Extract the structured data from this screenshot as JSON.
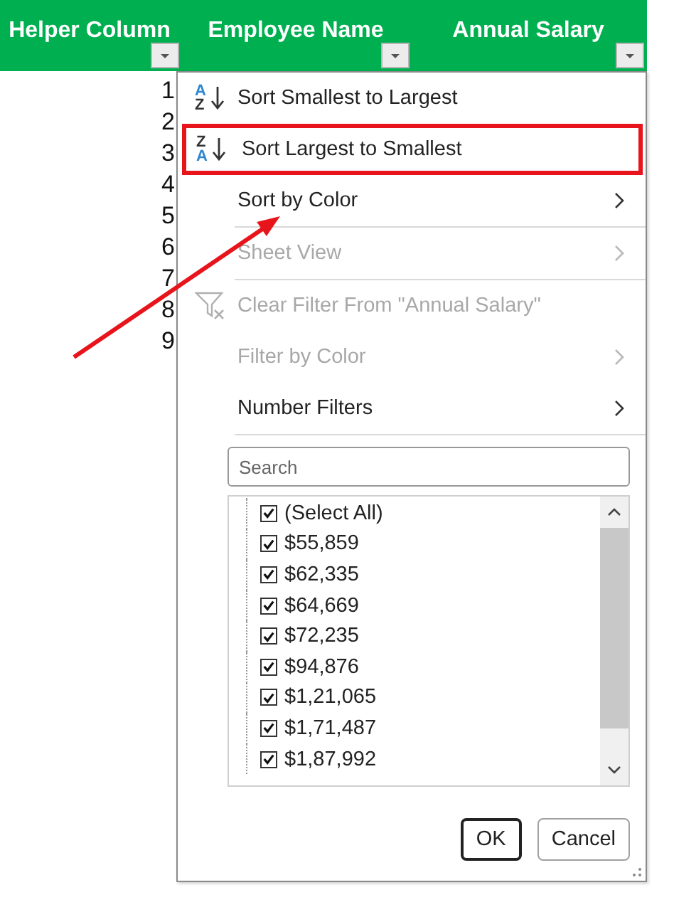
{
  "header": {
    "columns": [
      {
        "title": "Helper Column"
      },
      {
        "title": "Employee Name"
      },
      {
        "title": "Annual Salary"
      }
    ]
  },
  "rows": [
    "1",
    "2",
    "3",
    "4",
    "5",
    "6",
    "7",
    "8",
    "9"
  ],
  "filter_menu": {
    "items": [
      {
        "kind": "sort-ascending",
        "label": "Sort Smallest to Largest",
        "icon_letters": [
          "A",
          "Z"
        ],
        "disabled": false,
        "submenu": false,
        "annotated": false,
        "separator_before": false
      },
      {
        "kind": "sort-descending",
        "label": "Sort Largest to Smallest",
        "icon_letters": [
          "Z",
          "A"
        ],
        "disabled": false,
        "submenu": false,
        "annotated": true,
        "separator_before": false
      },
      {
        "kind": "plain",
        "label": "Sort by Color",
        "disabled": false,
        "submenu": true,
        "annotated": false,
        "separator_before": false
      },
      {
        "kind": "plain",
        "label": "Sheet View",
        "disabled": true,
        "submenu": true,
        "annotated": false,
        "separator_before": true
      },
      {
        "kind": "clear-filter",
        "label": "Clear Filter From \"Annual Salary\"",
        "disabled": true,
        "submenu": false,
        "annotated": false,
        "separator_before": true
      },
      {
        "kind": "plain",
        "label": "Filter by Color",
        "disabled": true,
        "submenu": true,
        "annotated": false,
        "separator_before": false
      },
      {
        "kind": "plain",
        "label": "Number Filters",
        "disabled": false,
        "submenu": true,
        "annotated": false,
        "separator_before": false
      }
    ],
    "search": {
      "placeholder": "Search"
    },
    "values": [
      {
        "label": "(Select All)",
        "checked": true
      },
      {
        "label": "$55,859",
        "checked": true
      },
      {
        "label": "$62,335",
        "checked": true
      },
      {
        "label": "$64,669",
        "checked": true
      },
      {
        "label": "$72,235",
        "checked": true
      },
      {
        "label": "$94,876",
        "checked": true
      },
      {
        "label": "$1,21,065",
        "checked": true
      },
      {
        "label": "$1,71,487",
        "checked": true
      },
      {
        "label": "$1,87,992",
        "checked": true
      }
    ],
    "buttons": [
      {
        "label": "OK",
        "default": true
      },
      {
        "label": "Cancel",
        "default": false
      }
    ]
  },
  "annotation": {
    "kind": "arrow"
  }
}
